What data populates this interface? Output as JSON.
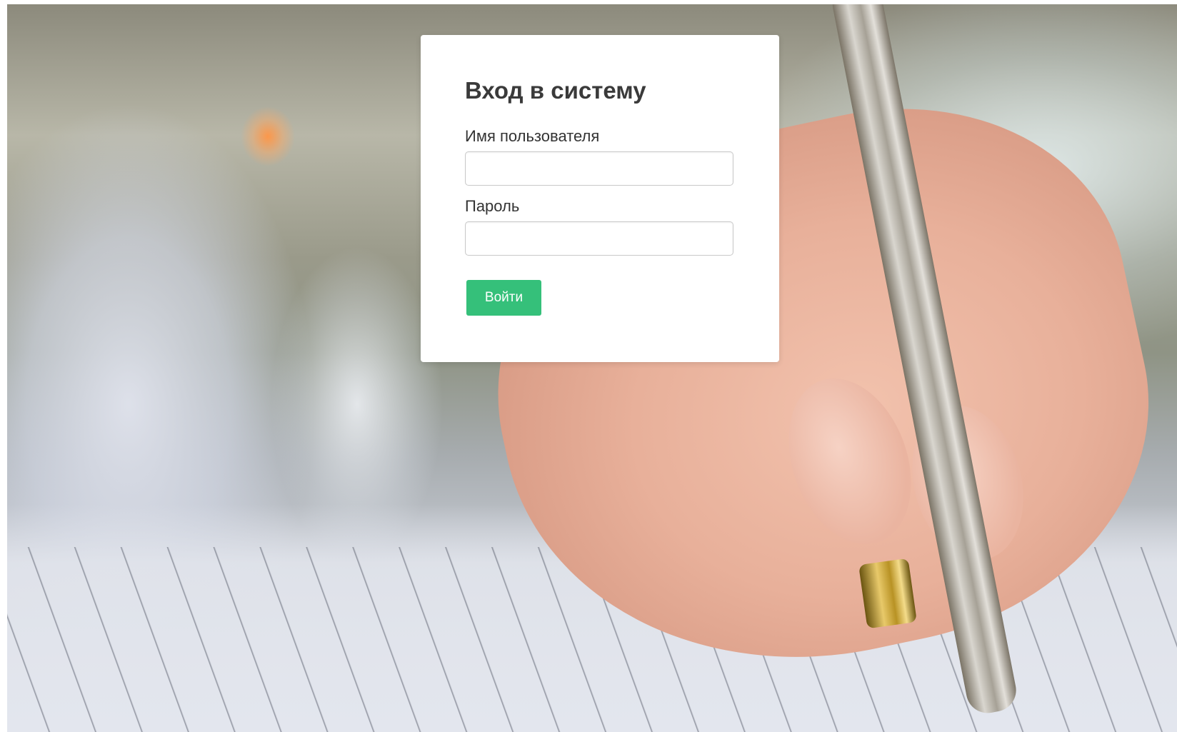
{
  "login_form": {
    "title": "Вход в систему",
    "username_label": "Имя пользователя",
    "username_value": "",
    "password_label": "Пароль",
    "password_value": "",
    "submit_label": "Войти"
  },
  "colors": {
    "submit_button": "#35c07a",
    "card_background": "#ffffff",
    "title_text": "#3a3a3a"
  }
}
